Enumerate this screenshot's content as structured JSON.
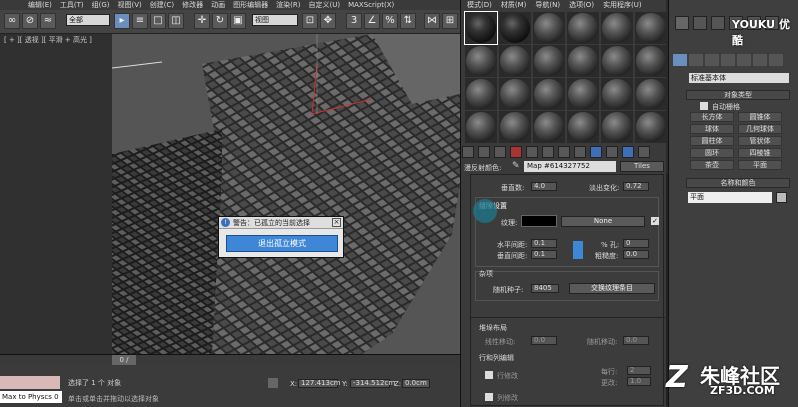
{
  "app": {
    "logo": "3ds"
  },
  "menubar": [
    "编辑(E)",
    "工具(T)",
    "组(G)",
    "视图(V)",
    "创建(C)",
    "修改器",
    "动画",
    "图形编辑器",
    "渲染(R)",
    "自定义(U)",
    "MAXScript(X)"
  ],
  "toolbar": {
    "filter": "全部",
    "refcoord": "视图"
  },
  "viewport": {
    "label": "[ + ][ 透视 ][ 平滑 + 高光 ]"
  },
  "dialog": {
    "title": "警告：已孤立的当前选择",
    "button": "退出孤立模式"
  },
  "timeline": {
    "frame": "0 / 100"
  },
  "status": {
    "listener": "Max to Physcs 0",
    "selected": "选择了 1 个 对象",
    "hint": "单击或单击并拖动以选择对象",
    "x_label": "X:",
    "x_value": "127.413cm",
    "y_label": "Y:",
    "y_value": "-314.512cm",
    "z_label": "Z:",
    "z_value": "0.0cm"
  },
  "material_editor": {
    "menu": [
      "模式(D)",
      "材质(M)",
      "导航(N)",
      "选项(O)",
      "实用程序(U)"
    ],
    "map_label": "漫反射颜色:",
    "map_name": "Map #614327752",
    "map_type": "Tiles",
    "vert_count_label": "垂直数:",
    "vert_count": "4.0",
    "fade_label": "淡出变化:",
    "fade": "0.72",
    "grout_title": "缝隙设置",
    "texture_label": "纹理:",
    "texture_none": "None",
    "hgap_label": "水平间距:",
    "hgap": "0.1",
    "vgap_label": "垂直间距:",
    "vgap": "0.1",
    "holes_label": "% 孔:",
    "holes": "0",
    "rough_label": "粗糙度:",
    "rough": "0.0",
    "misc_title": "杂项",
    "seed_label": "随机种子:",
    "seed": "8405",
    "swap_button": "交换纹理条目",
    "stack_title": "堆垛布局",
    "line_shift_label": "线性移动:",
    "line_shift": "0.0",
    "random_shift_label": "随机移动:",
    "random_shift": "0.0",
    "row_col_title": "行和列编辑",
    "row_edit": "行修改",
    "col_edit": "列修改",
    "per_row": "每行:",
    "per_row_val": "2",
    "change": "更改:",
    "change_val": "1.0"
  },
  "command_panel": {
    "object_type_title": "对象类型",
    "autogrid": "自动栅格",
    "dropdown": "标准基本体",
    "buttons": [
      "长方体",
      "圆锥体",
      "球体",
      "几何球体",
      "圆柱体",
      "管状体",
      "圆环",
      "四棱锥",
      "茶壶",
      "平面"
    ],
    "name_color_title": "名称和颜色",
    "object_name": "平面"
  },
  "watermark": {
    "top": "YOUKU 优酷",
    "bottom": "朱峰社区",
    "url": "ZF3D.COM"
  },
  "colors": {
    "accent": "#3e86d6",
    "viewport_bg": "#555555"
  }
}
